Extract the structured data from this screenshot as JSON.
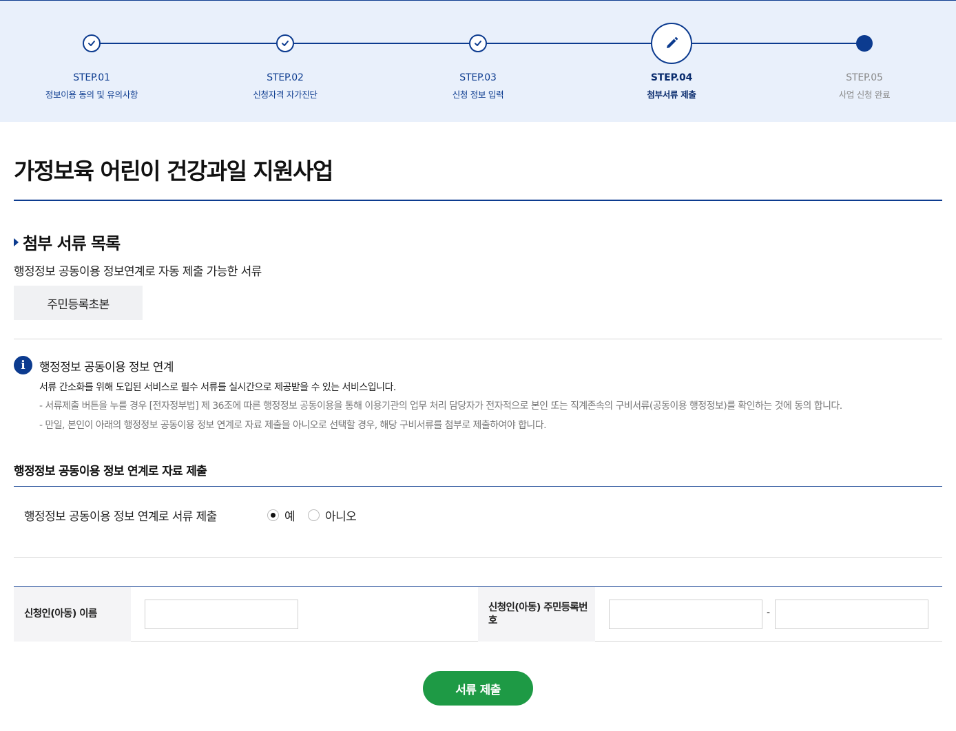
{
  "stepper": {
    "steps": [
      {
        "num": "STEP.01",
        "name": "정보이용 동의 및 유의사항",
        "state": "done"
      },
      {
        "num": "STEP.02",
        "name": "신청자격 자가진단",
        "state": "done"
      },
      {
        "num": "STEP.03",
        "name": "신청 정보 입력",
        "state": "done"
      },
      {
        "num": "STEP.04",
        "name": "첨부서류 제출",
        "state": "current"
      },
      {
        "num": "STEP.05",
        "name": "사업 신청 완료",
        "state": "upcoming"
      }
    ],
    "icons": {
      "done": "check-icon",
      "current": "pencil-icon",
      "upcoming": "dot-icon"
    },
    "accent_color": "#0c3b8f"
  },
  "page": {
    "title": "가정보육 어린이 건강과일 지원사업"
  },
  "attachments": {
    "title": "첨부 서류 목록",
    "description": "행정정보 공동이용 정보연계로 자동 제출 가능한 서류",
    "documents": [
      "주민등록초본"
    ]
  },
  "info": {
    "icon": "info-icon",
    "title": "행정정보 공동이용 정보 연계",
    "line1": "서류 간소화를 위해 도입된 서비스로 필수 서류를 실시간으로 제공받을 수 있는 서비스입니다.",
    "line2": "- 서류제출 버튼을 누를 경우 [전자정부법] 제 36조에 따른 행정정보 공동이용을 통해 이용기관의 업무 처리 담당자가 전자적으로 본인 또는 직계존속의 구비서류(공동이용 행정정보)를 확인하는 것에 동의 합니다.",
    "line3": "- 만일, 본인이 아래의 행정정보 공동이용 정보 연계로 자료 제출을 아니오로 선택할 경우, 해당 구비서류를 첨부로 제출하여야 합니다."
  },
  "linkage": {
    "title": "행정정보 공동이용 정보 연계로 자료 제출",
    "question": "행정정보 공동이용 정보 연계로 서류 제출",
    "options": [
      {
        "label": "예",
        "selected": true
      },
      {
        "label": "아니오",
        "selected": false
      }
    ]
  },
  "applicant": {
    "name_label": "신청인(아동) 이름",
    "name_value": "",
    "rrn_label": "신청인(아동) 주민등록번호",
    "rrn_front": "",
    "rrn_separator": "-",
    "rrn_back": ""
  },
  "actions": {
    "submit_label": "서류 제출",
    "submit_color": "#1e9a45"
  }
}
